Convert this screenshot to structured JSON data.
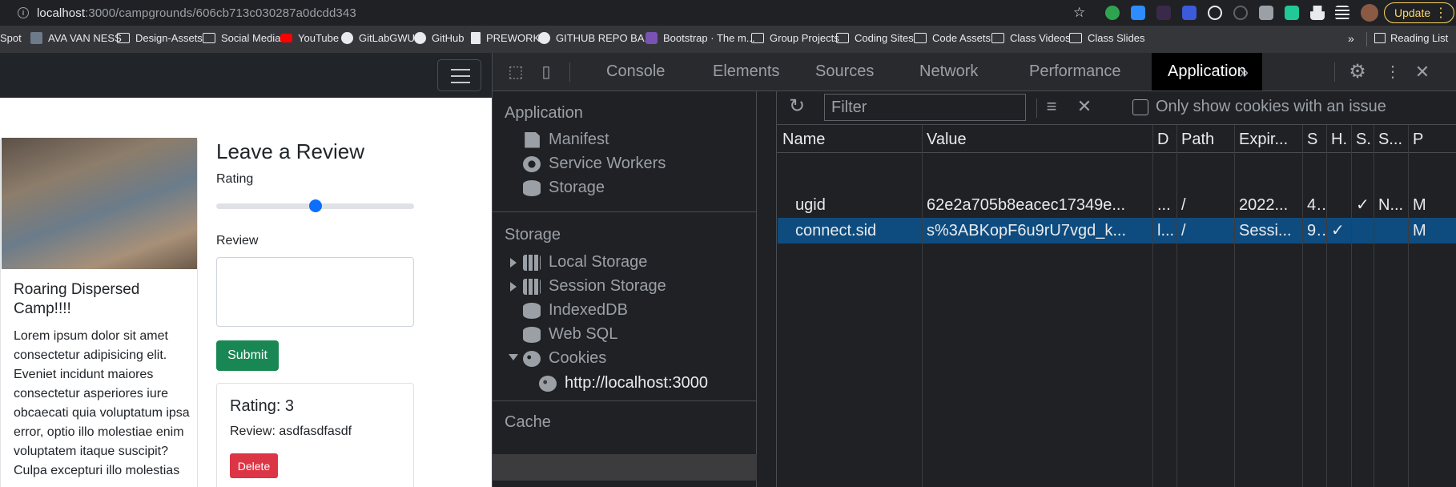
{
  "address_bar": {
    "host": "localhost",
    "path": ":3000/campgrounds/606cb713c030287a0dcdd343",
    "update_label": "Update"
  },
  "bookmarks": [
    {
      "label": "Spot",
      "icon": "none"
    },
    {
      "label": "AVA VAN NESS",
      "icon": "image-icon"
    },
    {
      "label": "Design-Assets",
      "icon": "folder-icon"
    },
    {
      "label": "Social Media",
      "icon": "folder-icon"
    },
    {
      "label": "YouTube",
      "icon": "youtube-icon"
    },
    {
      "label": "GitLabGWU",
      "icon": "gitlab-icon"
    },
    {
      "label": "GitHub",
      "icon": "github-icon"
    },
    {
      "label": "PREWORK",
      "icon": "page-icon"
    },
    {
      "label": "GITHUB REPO BA...",
      "icon": "github-icon"
    },
    {
      "label": "Bootstrap · The m...",
      "icon": "bootstrap-icon"
    },
    {
      "label": "Group Projects",
      "icon": "folder-icon"
    },
    {
      "label": "Coding Sites",
      "icon": "folder-icon"
    },
    {
      "label": "Code Assets",
      "icon": "folder-icon"
    },
    {
      "label": "Class Videos",
      "icon": "folder-icon"
    },
    {
      "label": "Class Slides",
      "icon": "folder-icon"
    }
  ],
  "bookmarks_more": "»",
  "reading_list": "Reading List",
  "camp": {
    "title": "Roaring Dispersed Camp!!!!",
    "description": "Lorem ipsum dolor sit amet consectetur adipisicing elit. Eveniet incidunt maiores consectetur asperiores iure obcaecati quia voluptatum ipsa error, optio illo molestiae enim voluptatem itaque suscipit? Culpa excepturi illo molestias"
  },
  "review_form": {
    "heading": "Leave a Review",
    "rating_label": "Rating",
    "rating_value": 0.5,
    "review_label": "Review",
    "submit_label": "Submit"
  },
  "review": {
    "rating": "Rating: 3",
    "text": "Review: asdfasdfasdf",
    "delete_label": "Delete"
  },
  "devtools": {
    "tabs": [
      "Console",
      "Elements",
      "Sources",
      "Network",
      "Performance",
      "Application"
    ],
    "active_tab": "Application",
    "more_tabs": "»",
    "sidebar": {
      "application_header": "Application",
      "application_items": [
        "Manifest",
        "Service Workers",
        "Storage"
      ],
      "storage_header": "Storage",
      "storage_items": [
        "Local Storage",
        "Session Storage",
        "IndexedDB",
        "Web SQL",
        "Cookies"
      ],
      "cookie_origin": "http://localhost:3000",
      "cache_header": "Cache"
    },
    "filter_placeholder": "Filter",
    "only_issues_label": "Only show cookies with an issue",
    "columns": [
      "Name",
      "Value",
      "D",
      "Path",
      "Expir...",
      "S",
      "H.",
      "S.",
      "S...",
      "P"
    ],
    "rows": [
      [
        "ugid",
        "62e2a705b8eacec17349e...",
        "...",
        "/",
        "2022...",
        "4...",
        "",
        "✓",
        "N...",
        "M"
      ],
      [
        "connect.sid",
        "s%3ABKopF6u9rU7vgd_k...",
        "l...",
        "/",
        "Sessi...",
        "9...",
        "✓",
        "",
        "",
        "M"
      ]
    ],
    "selected_row": 1
  }
}
